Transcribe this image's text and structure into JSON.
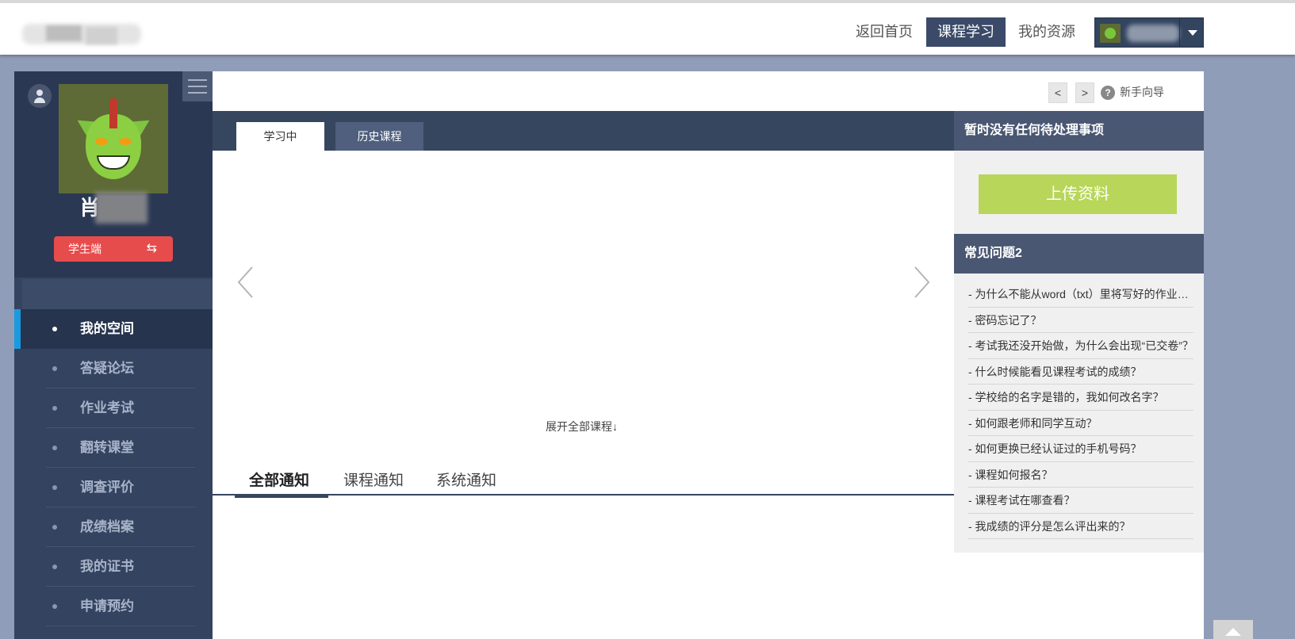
{
  "header": {
    "nav": {
      "home": "返回首页",
      "course_study": "课程学习",
      "my_resources": "我的资源"
    }
  },
  "sidebar": {
    "user_name": "肖",
    "role_button": "学生端",
    "role_icon": "⇆",
    "items": [
      {
        "label": "我的空间",
        "active": true
      },
      {
        "label": "答疑论坛",
        "active": false
      },
      {
        "label": "作业考试",
        "active": false
      },
      {
        "label": "翻转课堂",
        "active": false
      },
      {
        "label": "调查评价",
        "active": false
      },
      {
        "label": "成绩档案",
        "active": false
      },
      {
        "label": "我的证书",
        "active": false
      },
      {
        "label": "申请预约",
        "active": false
      }
    ]
  },
  "main": {
    "pager_prev": "<",
    "pager_next": ">",
    "guide_icon": "?",
    "guide": "新手向导",
    "course_tabs": [
      "学习中",
      "历史课程"
    ],
    "expand_all": "展开全部课程↓",
    "notice_tabs": [
      "全部通知",
      "课程通知",
      "系统通知"
    ]
  },
  "right_panel": {
    "todo_title": "暂时没有任何待处理事项",
    "upload_button": "上传资料",
    "faq_title": "常见问题2",
    "faq": [
      "- 为什么不能从word（txt）里将写好的作业复制粘贴到作业框内？",
      "- 密码忘记了？",
      "- 考试我还没开始做，为什么会出现“已交卷”？",
      "- 什么时候能看见课程考试的成绩？",
      "- 学校给的名字是错的，我如何改名字？",
      "- 如何跟老师和同学互动？",
      "- 如何更换已经认证过的手机号码？",
      "- 课程如何报名？",
      "- 课程考试在哪查看？",
      "- 我成绩的评分是怎么评出来的？"
    ]
  },
  "colors": {
    "background": "#909db8",
    "sidebar": "#344360",
    "active_accent": "#1a9ae0",
    "header_active": "#3a4a68",
    "role_button": "#e74c4c",
    "upload_button": "#b8d65a"
  }
}
